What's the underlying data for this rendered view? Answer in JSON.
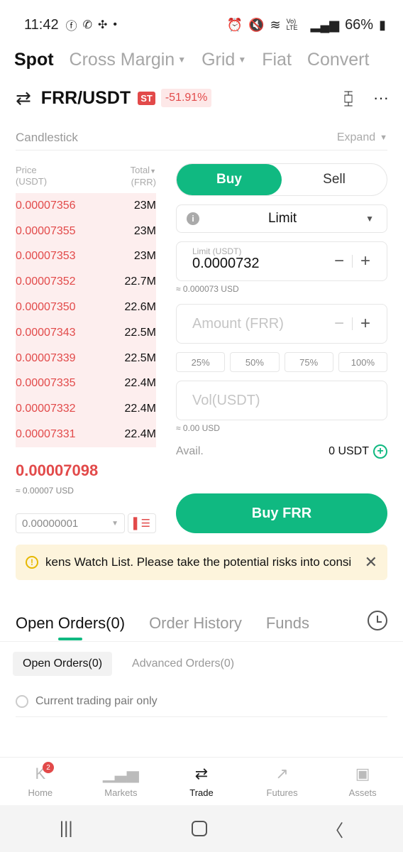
{
  "status_bar": {
    "time": "11:42",
    "battery": "66%",
    "network_label": "Vo) LTE"
  },
  "top_tabs": [
    {
      "label": "Spot",
      "active": true,
      "dropdown": false
    },
    {
      "label": "Cross Margin",
      "active": false,
      "dropdown": true
    },
    {
      "label": "Grid",
      "active": false,
      "dropdown": true
    },
    {
      "label": "Fiat",
      "active": false,
      "dropdown": false
    },
    {
      "label": "Convert",
      "active": false,
      "dropdown": false
    }
  ],
  "pair": {
    "name": "FRR/USDT",
    "tag": "ST",
    "change": "-51.91%"
  },
  "chart_section": {
    "label": "Candlestick",
    "expand_label": "Expand"
  },
  "order_book": {
    "price_header": "Price",
    "price_unit": "(USDT)",
    "total_header": "Total",
    "total_unit": "(FRR)",
    "asks": [
      {
        "price": "0.00007356",
        "total": "23M"
      },
      {
        "price": "0.00007355",
        "total": "23M"
      },
      {
        "price": "0.00007353",
        "total": "23M"
      },
      {
        "price": "0.00007352",
        "total": "22.7M"
      },
      {
        "price": "0.00007350",
        "total": "22.6M"
      },
      {
        "price": "0.00007343",
        "total": "22.5M"
      },
      {
        "price": "0.00007339",
        "total": "22.5M"
      },
      {
        "price": "0.00007335",
        "total": "22.4M"
      },
      {
        "price": "0.00007332",
        "total": "22.4M"
      },
      {
        "price": "0.00007331",
        "total": "22.4M"
      }
    ],
    "last_price": "0.00007098",
    "last_price_usd": "≈ 0.00007 USD",
    "precision": "0.00000001"
  },
  "form": {
    "buy_label": "Buy",
    "sell_label": "Sell",
    "order_type": "Limit",
    "limit_label": "Limit (USDT)",
    "limit_value": "0.0000732",
    "limit_usd": "≈ 0.000073 USD",
    "amount_placeholder": "Amount (FRR)",
    "percentages": [
      "25%",
      "50%",
      "75%",
      "100%"
    ],
    "vol_placeholder": "Vol(USDT)",
    "vol_usd": "≈ 0.00 USD",
    "avail_label": "Avail.",
    "avail_value": "0 USDT",
    "submit_label": "Buy FRR"
  },
  "banner": {
    "text": "kens Watch List. Please take the potential risks into consi"
  },
  "orders": {
    "tabs": [
      {
        "label": "Open Orders(0)",
        "active": true
      },
      {
        "label": "Order History",
        "active": false
      },
      {
        "label": "Funds",
        "active": false
      }
    ],
    "subtabs": [
      {
        "label": "Open Orders(0)",
        "active": true
      },
      {
        "label": "Advanced Orders(0)",
        "active": false
      }
    ],
    "pair_only_label": "Current trading pair only"
  },
  "bottom_nav": [
    {
      "label": "Home",
      "icon": "home-icon",
      "badge": "2",
      "active": false
    },
    {
      "label": "Markets",
      "icon": "markets-icon",
      "active": false
    },
    {
      "label": "Trade",
      "icon": "trade-icon",
      "active": true
    },
    {
      "label": "Futures",
      "icon": "futures-icon",
      "active": false
    },
    {
      "label": "Assets",
      "icon": "assets-icon",
      "active": false
    }
  ],
  "colors": {
    "accent_green": "#10b981",
    "ask_red": "#e24a4a",
    "banner_bg": "#fdf4dc"
  }
}
